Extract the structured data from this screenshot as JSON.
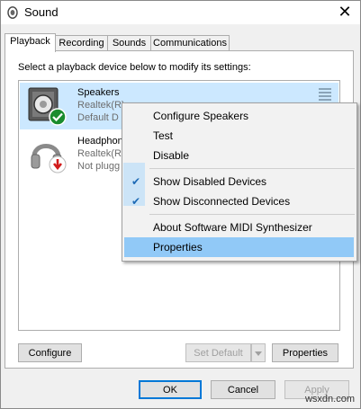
{
  "window": {
    "title": "Sound",
    "close_symbol": "✕"
  },
  "tabs": [
    {
      "label": "Playback",
      "active": true
    },
    {
      "label": "Recording",
      "active": false
    },
    {
      "label": "Sounds",
      "active": false
    },
    {
      "label": "Communications",
      "active": false
    }
  ],
  "instruction": "Select a playback device below to modify its settings:",
  "devices": [
    {
      "name": "Speakers",
      "driver": "Realtek(R)",
      "status": "Default D",
      "icon": "speaker-icon",
      "badge": "green-check-badge-icon",
      "selected": true
    },
    {
      "name": "Headphon",
      "driver": "Realtek(R)",
      "status": "Not plugg",
      "icon": "headphones-icon",
      "badge": "red-down-arrow-badge-icon",
      "selected": false
    }
  ],
  "context_menu": {
    "items": [
      {
        "label": "Configure Speakers",
        "checked": false,
        "highlighted": false
      },
      {
        "label": "Test",
        "checked": false,
        "highlighted": false
      },
      {
        "label": "Disable",
        "checked": false,
        "highlighted": false
      },
      {
        "label": "Show Disabled Devices",
        "checked": true,
        "highlighted": false
      },
      {
        "label": "Show Disconnected Devices",
        "checked": true,
        "highlighted": false
      },
      {
        "label": "About Software MIDI Synthesizer",
        "checked": false,
        "highlighted": false
      },
      {
        "label": "Properties",
        "checked": false,
        "highlighted": true
      }
    ],
    "check_symbol": "✔"
  },
  "buttons": {
    "configure": "Configure",
    "set_default": "Set Default",
    "properties": "Properties",
    "ok": "OK",
    "cancel": "Cancel",
    "apply": "Apply"
  },
  "watermark": "wsxdn.com",
  "colors": {
    "selection": "#cce8ff",
    "menu_highlight": "#91c9f7",
    "accent": "#0078d7",
    "check": "#1e6ab5"
  }
}
